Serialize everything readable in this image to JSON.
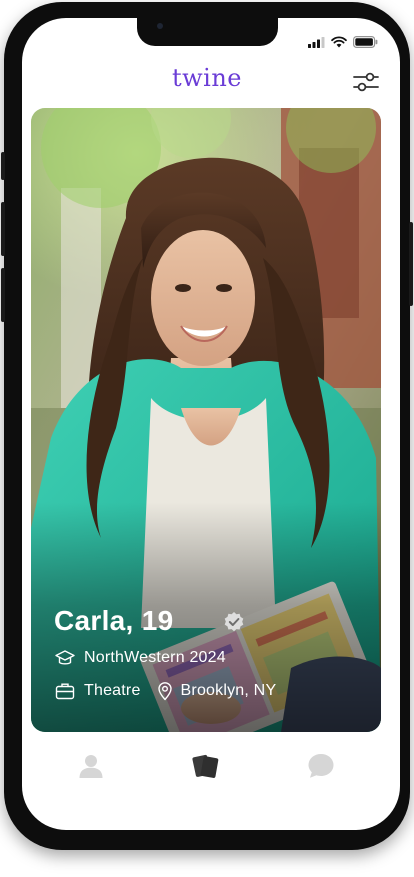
{
  "app": {
    "logo_text": "twine",
    "accent_color": "#6a3cd6"
  },
  "status_bar": {
    "icons": [
      "signal-icon",
      "wifi-icon",
      "battery-icon"
    ]
  },
  "header": {
    "filter_icon": "sliders-icon"
  },
  "profile_card": {
    "photo_description_icon": "profile-photo",
    "name_age": "Carla, 19",
    "verified_icon": "check-badge-icon",
    "school": {
      "icon": "graduation-cap-icon",
      "text": "NorthWestern 2024"
    },
    "occupation": {
      "icon": "briefcase-icon",
      "text": "Theatre"
    },
    "location": {
      "icon": "location-pin-icon",
      "text": "Brooklyn, NY"
    }
  },
  "bottom_nav": {
    "items": [
      {
        "name": "profile",
        "icon": "person-icon",
        "active": false
      },
      {
        "name": "cards",
        "icon": "cards-icon",
        "active": true
      },
      {
        "name": "messages",
        "icon": "chat-bubble-icon",
        "active": false
      }
    ],
    "active_color": "#2f2f2f",
    "inactive_color": "#d6d6d6"
  }
}
